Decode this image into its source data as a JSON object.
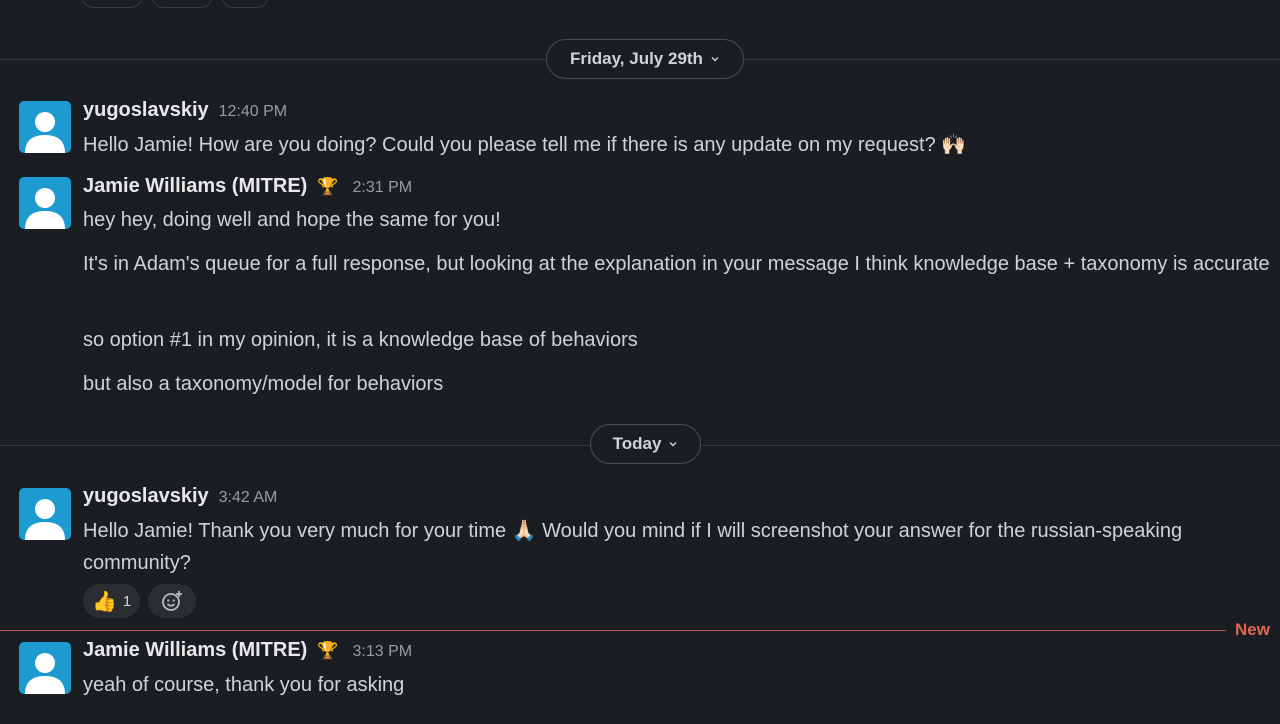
{
  "dividers": {
    "friday": "Friday, July 29th",
    "today": "Today"
  },
  "messages": [
    {
      "author": "yugoslavskiy",
      "time": "12:40 PM",
      "lines": [
        "Hello Jamie! How are you doing? Could you please tell me if there is any update on my request? 🙌🏻"
      ]
    },
    {
      "author": "Jamie Williams (MITRE)",
      "badge_icon": "trophy-icon",
      "time": "2:31 PM",
      "lines": [
        "hey hey, doing well and hope the same for you!",
        "It's in Adam's queue for a full response, but looking at the explanation in your message I think knowledge base + taxonomy is accurate",
        "so option #1 in my opinion, it is a knowledge base of behaviors",
        "but also a taxonomy/model for behaviors"
      ]
    },
    {
      "author": "yugoslavskiy",
      "time": "3:42 AM",
      "lines": [
        "Hello Jamie! Thank you very much for your time 🙏🏻 Would you mind if I will screenshot your answer for the russian-speaking community?"
      ],
      "reactions": [
        {
          "emoji": "👍",
          "count": "1"
        }
      ]
    },
    {
      "author": "Jamie Williams (MITRE)",
      "badge_icon": "trophy-icon",
      "time": "3:13 PM",
      "lines": [
        "yeah of course, thank you for asking"
      ]
    }
  ],
  "new_marker": "New",
  "colors": {
    "background": "#1a1d21",
    "text": "#d1d2d3",
    "avatar": "#1d9bd1",
    "new_marker": "#e0674f"
  }
}
